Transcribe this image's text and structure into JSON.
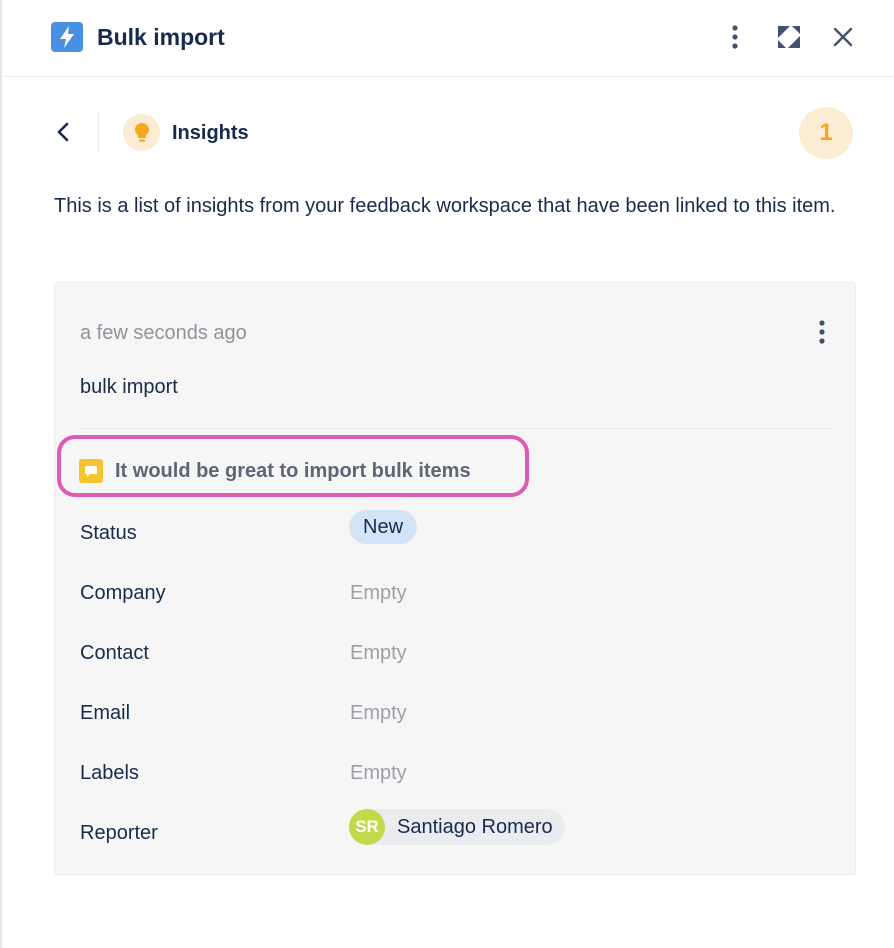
{
  "header": {
    "title": "Bulk import",
    "icons": {
      "app": "lightning-bolt-icon",
      "more": "vertical-dots-icon",
      "expand": "expand-diagonal-icon",
      "close": "close-icon"
    },
    "accent_color": "#4a90e2"
  },
  "subheader": {
    "label": "Insights",
    "count": "1",
    "icons": {
      "back": "chevron-left-icon",
      "insight": "lightbulb-icon"
    },
    "badge_color": "#f5a623"
  },
  "description": "This is a list of insights from your feedback workspace that have been linked to this item.",
  "insight_card": {
    "timestamp": "a few seconds ago",
    "item_name": "bulk import",
    "quote": "It would be great to import bulk items",
    "highlight_color": "#dd5bb4",
    "fields": {
      "status": {
        "label": "Status",
        "value": "New"
      },
      "company": {
        "label": "Company",
        "value": "Empty"
      },
      "contact": {
        "label": "Contact",
        "value": "Empty"
      },
      "email": {
        "label": "Email",
        "value": "Empty"
      },
      "labels": {
        "label": "Labels",
        "value": "Empty"
      },
      "reporter": {
        "label": "Reporter",
        "initials": "SR",
        "name": "Santiago Romero"
      }
    }
  }
}
